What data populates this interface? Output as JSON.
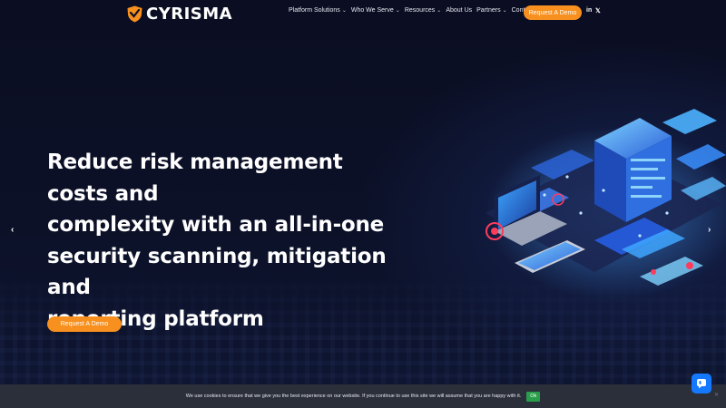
{
  "brand": {
    "name": "CYRISMA",
    "accent": "#f7901e",
    "background": "#0b0f24"
  },
  "nav": {
    "items": [
      {
        "label": "Platform Solutions",
        "has_dropdown": true
      },
      {
        "label": "Who We Serve",
        "has_dropdown": true
      },
      {
        "label": "Resources",
        "has_dropdown": true
      },
      {
        "label": "About Us",
        "has_dropdown": false
      },
      {
        "label": "Partners",
        "has_dropdown": true
      },
      {
        "label": "Contact Us",
        "has_dropdown": false
      }
    ],
    "cta_label": "Request A Demo",
    "social": {
      "linkedin": "in",
      "x": "𝕏"
    }
  },
  "hero": {
    "headline": [
      "Reduce risk management costs and",
      "complexity with an all-in-one",
      "security scanning, mitigation and",
      "reporting platform"
    ],
    "cta_label": "Request A Demo",
    "prev_icon": "chevron-left-icon",
    "next_icon": "chevron-right-icon"
  },
  "cookie": {
    "text": "We use cookies to ensure that we give you the best experience on our website. If you continue to use this site we will assume that you are happy with it.",
    "ok_label": "Ok",
    "ok_color": "#2a9d4a"
  },
  "chat": {
    "icon": "chat-icon",
    "color": "#1479ff"
  }
}
